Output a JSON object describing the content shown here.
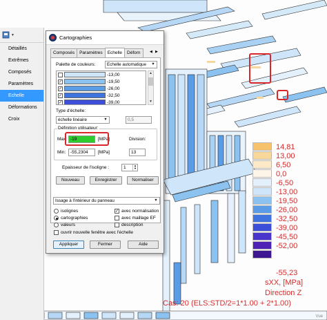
{
  "side_panel": {
    "items": [
      {
        "label": "Détaillés"
      },
      {
        "label": "Extrêmes"
      },
      {
        "label": "Composés"
      },
      {
        "label": "Paramètres"
      },
      {
        "label": "Echelle"
      },
      {
        "label": "Déformations"
      },
      {
        "label": "Croix"
      }
    ],
    "selected": "Echelle"
  },
  "dialog": {
    "title": "Cartographies",
    "tabs": [
      {
        "label": "Composés"
      },
      {
        "label": "Paramètres"
      },
      {
        "label": "Echelle"
      },
      {
        "label": "Déforn"
      }
    ],
    "active_tab": "Echelle",
    "palette": {
      "label": "Palette de couleurs:",
      "selected": "Echelle automatique",
      "rows": [
        {
          "checked": false,
          "value": "-13,00",
          "color": "#cfe6fa"
        },
        {
          "checked": true,
          "value": "-19,50",
          "color": "#8cc2ef"
        },
        {
          "checked": true,
          "value": "-26,00",
          "color": "#5a9de6"
        },
        {
          "checked": true,
          "value": "-32,50",
          "color": "#3f73e0"
        },
        {
          "checked": true,
          "value": "-39,00",
          "color": "#3d4fd8"
        }
      ]
    },
    "scale_type": {
      "label": "Type d'échelle:",
      "selected": "échelle linéaire",
      "value": "0,5"
    },
    "user_def": {
      "label": "Définition utilisateur:",
      "max_label": "Max:",
      "max_value": "-19",
      "max_unit": "[MPa]",
      "min_label": "Min:",
      "min_value": "-55,2304",
      "min_unit": "[MPa]",
      "division_label": "Division:",
      "division_value": "13"
    },
    "isoline": {
      "label": "Epaisseur de l'isoligne :",
      "value": "1"
    },
    "buttons": {
      "new": "Nouveau",
      "save": "Enregistrer",
      "normalize": "Normaliser",
      "apply": "Appliquer",
      "close": "Fermer",
      "help": "Aide"
    },
    "panel_combo": "Issage à l'intérieur du panneau",
    "options": {
      "isolignes": "isolignes",
      "cartographies": "cartographies",
      "valeurs": "valeurs",
      "avec_normalisation": "avec normalisation",
      "avec_maillage": "avec maillage EF",
      "description": "description",
      "ouvrir": "ouvrir nouvelle fenêtre avec l'échelle",
      "selected_radio": "cartographies"
    }
  },
  "legend": {
    "entries": [
      {
        "value": "14,81",
        "color": "#f6c26b"
      },
      {
        "value": "13,00",
        "color": "#f8d79a"
      },
      {
        "value": "6,50",
        "color": "#fbe9c8"
      },
      {
        "value": "0,0",
        "color": "#fdf6e8"
      },
      {
        "value": "-6,50",
        "color": "#e4f1fc"
      },
      {
        "value": "-13,00",
        "color": "#cfe6fa"
      },
      {
        "value": "-19,50",
        "color": "#8cc2ef"
      },
      {
        "value": "-26,00",
        "color": "#5a9de6"
      },
      {
        "value": "-32,50",
        "color": "#3f73e0"
      },
      {
        "value": "-39,00",
        "color": "#3d4fd8"
      },
      {
        "value": "-45,50",
        "color": "#4a36cc"
      },
      {
        "value": "-52,00",
        "color": "#4d22b4"
      },
      {
        "value": "-55,23",
        "color": "#3e1690"
      }
    ],
    "quantity": "sXX, [MPa]",
    "direction": "Direction Z",
    "case": "Cas: 20 (ELS:STD/2=1*1.00 + 2*1.00)"
  },
  "viewport": {
    "corner_label": "Vue"
  },
  "colors": {
    "highlight": "#d9262a",
    "max_field": "#2ecc2e",
    "legend_text": "#d62b2b",
    "selection": "#3399ff"
  }
}
